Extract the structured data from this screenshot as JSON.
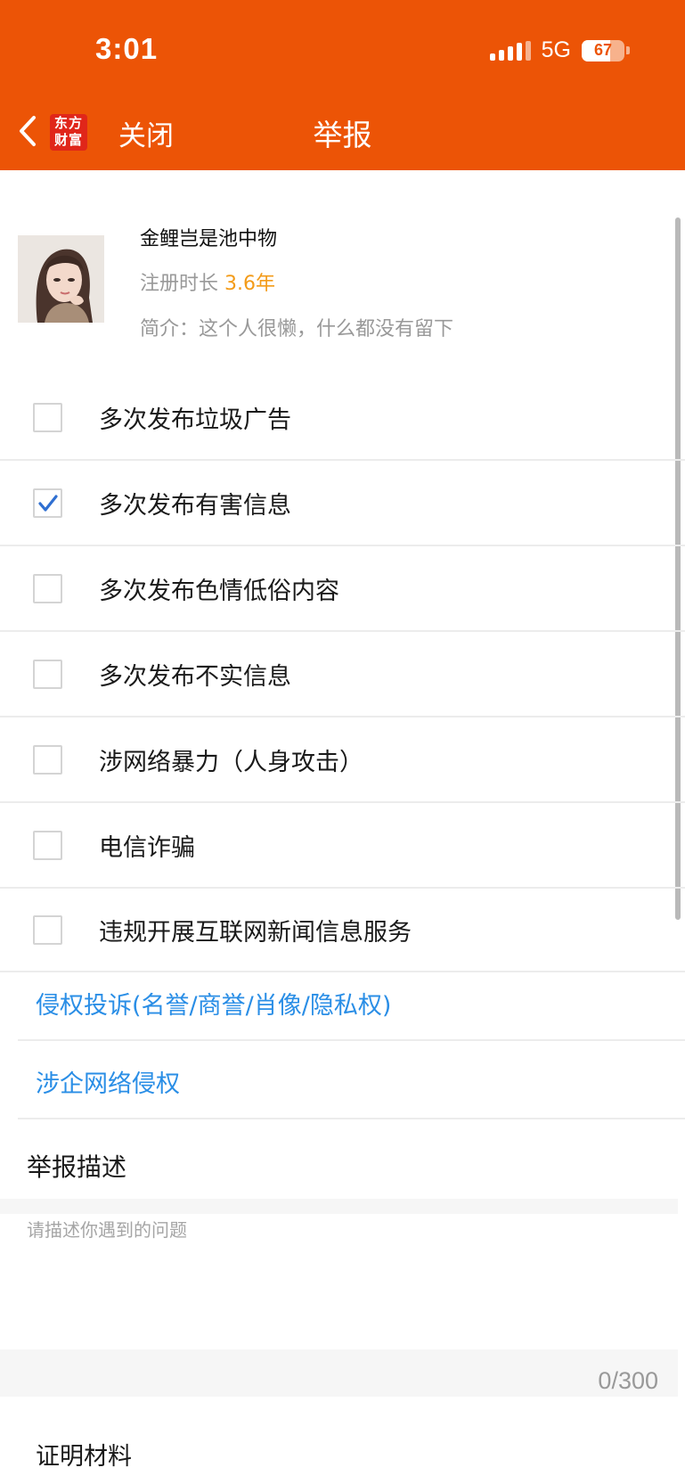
{
  "status_bar": {
    "time": "3:01",
    "network": "5G",
    "battery_level": 67,
    "battery_text": "67"
  },
  "nav": {
    "logo_line1": "东方",
    "logo_line2": "财富",
    "close_label": "关闭",
    "title": "举报"
  },
  "profile": {
    "username": "金鲤岂是池中物",
    "reg_label": "注册时长",
    "reg_value": "3.6年",
    "bio": "简介：这个人很懒，什么都没有留下"
  },
  "report_options": [
    {
      "label": "多次发布垃圾广告",
      "checked": false
    },
    {
      "label": "多次发布有害信息",
      "checked": true
    },
    {
      "label": "多次发布色情低俗内容",
      "checked": false
    },
    {
      "label": "多次发布不实信息",
      "checked": false
    },
    {
      "label": "涉网络暴力（人身攻击）",
      "checked": false
    },
    {
      "label": "电信诈骗",
      "checked": false
    },
    {
      "label": "违规开展互联网新闻信息服务",
      "checked": false
    }
  ],
  "links": {
    "infringement": "侵权投诉(名誉/商誉/肖像/隐私权)",
    "enterprise": "涉企网络侵权"
  },
  "description": {
    "title": "举报描述",
    "placeholder": "请描述你遇到的问题",
    "counter": "0/300"
  },
  "proof_title": "证明材料",
  "colors": {
    "brand": "#ec5406",
    "link": "#2a8ee6",
    "accent": "#f39b19",
    "check": "#2f6fd1"
  }
}
